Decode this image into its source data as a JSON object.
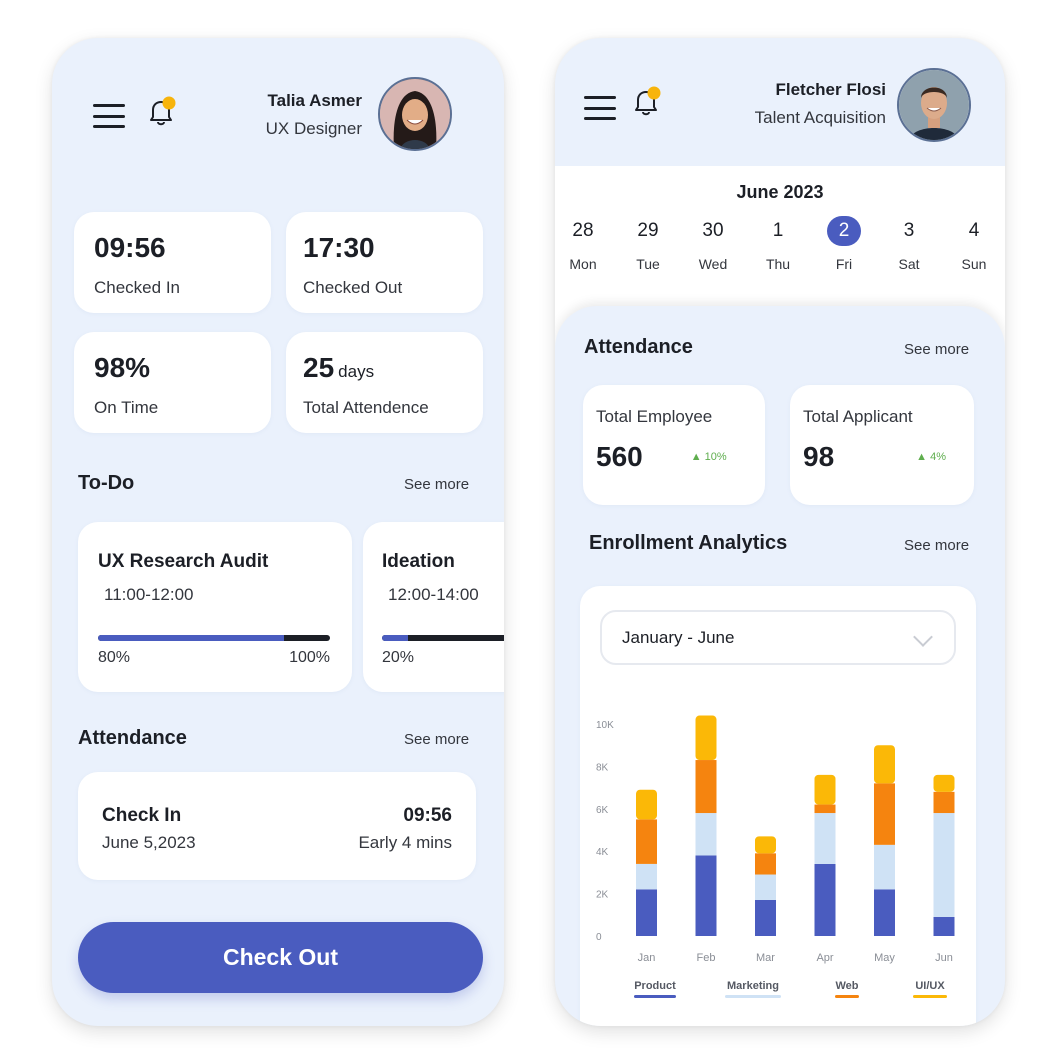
{
  "left_app": {
    "user": {
      "name": "Talia Asmer",
      "role": "UX Designer",
      "avatar": "avatar-photo-talia"
    },
    "icons": {
      "menu": "menu-icon",
      "notifications": "bell-icon",
      "notification_dot_color": "#f7b40c"
    },
    "stats": [
      {
        "value": "09:56",
        "unit": "",
        "label": "Checked In"
      },
      {
        "value": "17:30",
        "unit": "",
        "label": "Checked Out"
      },
      {
        "value": "98%",
        "unit": "",
        "label": "On Time"
      },
      {
        "value": "25",
        "unit": "days",
        "label": "Total Attendence"
      }
    ],
    "todo": {
      "title": "To-Do",
      "see_more": "See more",
      "items": [
        {
          "title": "UX Research Audit",
          "time": "11:00-12:00",
          "progress": 0.8,
          "progress_label": "80%",
          "max_label": "100%"
        },
        {
          "title": "Ideation",
          "time": "12:00-14:00",
          "progress": 0.2,
          "progress_label": "20%",
          "max_label": ""
        }
      ]
    },
    "attendance": {
      "title": "Attendance",
      "see_more": "See more",
      "record": {
        "label": "Check In",
        "date": "June 5,2023",
        "time": "09:56",
        "note": "Early 4 mins"
      }
    },
    "checkout_button": "Check Out"
  },
  "right_app": {
    "user": {
      "name": "Fletcher Flosi",
      "role": "Talent Acquisition",
      "avatar": "avatar-photo-fletcher"
    },
    "icons": {
      "menu": "menu-icon",
      "notifications": "bell-icon",
      "notification_dot_color": "#f7b40c"
    },
    "calendar": {
      "month": "June 2023",
      "days": [
        {
          "num": "28",
          "dow": "Mon",
          "selected": false
        },
        {
          "num": "29",
          "dow": "Tue",
          "selected": false
        },
        {
          "num": "30",
          "dow": "Wed",
          "selected": false
        },
        {
          "num": "1",
          "dow": "Thu",
          "selected": false
        },
        {
          "num": "2",
          "dow": "Fri",
          "selected": true
        },
        {
          "num": "3",
          "dow": "Sat",
          "selected": false
        },
        {
          "num": "4",
          "dow": "Sun",
          "selected": false
        }
      ]
    },
    "attendance": {
      "title": "Attendance",
      "see_more": "See more",
      "metrics": [
        {
          "label": "Total Employee",
          "value": "560",
          "change": "10%",
          "trend": "up"
        },
        {
          "label": "Total Applicant",
          "value": "98",
          "change": "4%",
          "trend": "up"
        }
      ]
    },
    "enrollment": {
      "title": "Enrollment Analytics",
      "see_more": "See more",
      "range_selected": "January - June"
    }
  },
  "colors": {
    "accent": "#4a5cbf",
    "background": "#eaf1fc",
    "positive": "#5fae4e"
  },
  "chart_data": {
    "type": "bar",
    "stacked": true,
    "title": "Enrollment Analytics",
    "categories": [
      "Jan",
      "Feb",
      "Mar",
      "Apr",
      "May",
      "Jun"
    ],
    "yticks": [
      "0",
      "2K",
      "4K",
      "6K",
      "8K",
      "10K"
    ],
    "ylim": [
      0,
      10000
    ],
    "grid": false,
    "legend_position": "bottom",
    "series": [
      {
        "name": "Product",
        "color": "#4a5cbf",
        "values": [
          2200,
          3800,
          1700,
          3400,
          2200,
          900
        ]
      },
      {
        "name": "Marketing",
        "color": "#cfe2f5",
        "values": [
          1200,
          2000,
          1200,
          2400,
          2100,
          4900
        ]
      },
      {
        "name": "Web",
        "color": "#f5840f",
        "values": [
          2100,
          2500,
          1000,
          400,
          2900,
          1000
        ]
      },
      {
        "name": "UI/UX",
        "color": "#fbb807",
        "values": [
          1400,
          2100,
          800,
          1400,
          1800,
          800
        ]
      }
    ]
  }
}
